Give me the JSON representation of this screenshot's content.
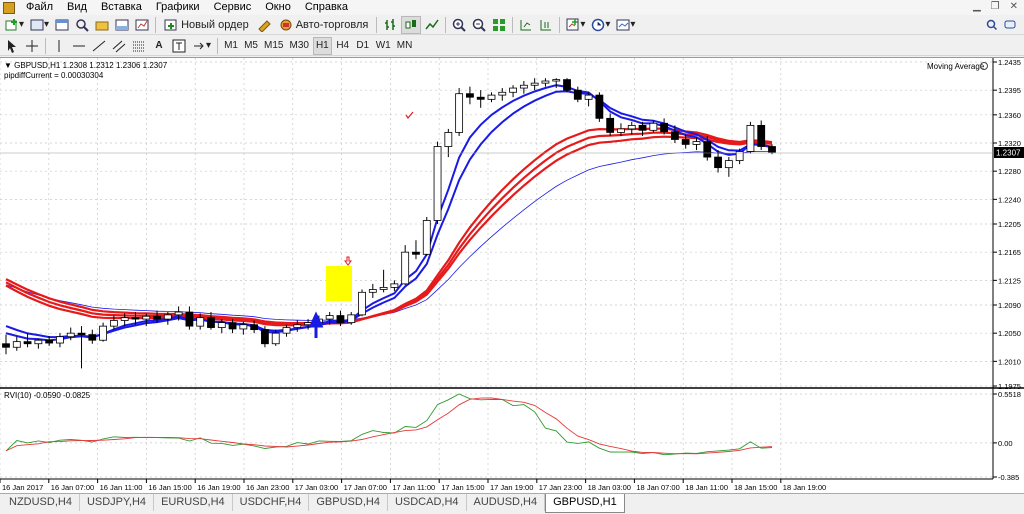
{
  "menu": [
    "Файл",
    "Вид",
    "Вставка",
    "Графики",
    "Сервис",
    "Окно",
    "Справка"
  ],
  "toolbar": {
    "new_order": "Новый ордер",
    "auto_trading": "Авто-торговля"
  },
  "timeframes": [
    "M1",
    "M5",
    "M15",
    "M30",
    "H1",
    "H4",
    "D1",
    "W1",
    "MN"
  ],
  "active_timeframe": "H1",
  "chart": {
    "info": "GBPUSD,H1  1.2308 1.2312 1.2306 1.2307",
    "indicator_label": "pipdiffCurrent = 0.00030304",
    "ma_label": "Moving Average",
    "current_price": "1.2307",
    "y_ticks": [
      "1.2435",
      "1.2395",
      "1.2360",
      "1.2320",
      "1.2280",
      "1.2240",
      "1.2205",
      "1.2165",
      "1.2125",
      "1.2090",
      "1.2050",
      "1.2010",
      "1.1975"
    ],
    "y_range": [
      1.1975,
      1.2435
    ]
  },
  "rvi": {
    "label": "RVI(10) -0.0590 -0.0825",
    "y_ticks": [
      "0.5518",
      "0.00",
      "-0.385"
    ]
  },
  "x_ticks": [
    "16 Jan 2017",
    "16 Jan 07:00",
    "16 Jan 11:00",
    "16 Jan 15:00",
    "16 Jan 19:00",
    "16 Jan 23:00",
    "17 Jan 03:00",
    "17 Jan 07:00",
    "17 Jan 11:00",
    "17 Jan 15:00",
    "17 Jan 19:00",
    "17 Jan 23:00",
    "18 Jan 03:00",
    "18 Jan 07:00",
    "18 Jan 11:00",
    "18 Jan 15:00",
    "18 Jan 19:00"
  ],
  "tabs": [
    "NZDUSD,H4",
    "USDJPY,H4",
    "EURUSD,H4",
    "USDCHF,H4",
    "GBPUSD,H4",
    "USDCAD,H4",
    "AUDUSD,H4",
    "GBPUSD,H1"
  ],
  "active_tab": "GBPUSD,H1",
  "colors": {
    "bull": "#ffffff",
    "bear": "#000000",
    "ma_blue": "#1a1ae6",
    "ma_red": "#e61a1a",
    "rvi_green": "#2e9a2e",
    "rvi_red": "#e63a3a",
    "highlight": "#ffff00"
  },
  "chart_data": {
    "type": "candlestick",
    "symbol": "GBPUSD",
    "timeframe": "H1",
    "ohlc": [
      [
        1.2035,
        1.2048,
        1.202,
        1.203
      ],
      [
        1.203,
        1.2045,
        1.2025,
        1.2038
      ],
      [
        1.2038,
        1.205,
        1.203,
        1.2035
      ],
      [
        1.2035,
        1.2042,
        1.2028,
        1.204
      ],
      [
        1.204,
        1.2046,
        1.2032,
        1.2036
      ],
      [
        1.2036,
        1.205,
        1.203,
        1.2045
      ],
      [
        1.2045,
        1.2058,
        1.204,
        1.205
      ],
      [
        1.205,
        1.206,
        1.2,
        1.2048
      ],
      [
        1.2048,
        1.2055,
        1.2035,
        1.204
      ],
      [
        1.204,
        1.2065,
        1.2038,
        1.206
      ],
      [
        1.206,
        1.2075,
        1.2055,
        1.2068
      ],
      [
        1.2068,
        1.2078,
        1.206,
        1.2072
      ],
      [
        1.2072,
        1.208,
        1.2062,
        1.207
      ],
      [
        1.207,
        1.2078,
        1.206,
        1.2074
      ],
      [
        1.2074,
        1.2082,
        1.2065,
        1.207
      ],
      [
        1.207,
        1.208,
        1.2062,
        1.2076
      ],
      [
        1.2076,
        1.2088,
        1.2068,
        1.208
      ],
      [
        1.208,
        1.2088,
        1.2055,
        1.206
      ],
      [
        1.206,
        1.2078,
        1.2055,
        1.2072
      ],
      [
        1.2072,
        1.208,
        1.2055,
        1.2058
      ],
      [
        1.2058,
        1.207,
        1.205,
        1.2065
      ],
      [
        1.2065,
        1.207,
        1.205,
        1.2056
      ],
      [
        1.2056,
        1.2066,
        1.2048,
        1.2062
      ],
      [
        1.2062,
        1.2068,
        1.205,
        1.2055
      ],
      [
        1.2055,
        1.206,
        1.203,
        1.2035
      ],
      [
        1.2035,
        1.2055,
        1.2032,
        1.205
      ],
      [
        1.205,
        1.2062,
        1.2045,
        1.2058
      ],
      [
        1.2058,
        1.2068,
        1.2052,
        1.2062
      ],
      [
        1.2062,
        1.207,
        1.2055,
        1.2065
      ],
      [
        1.2065,
        1.2075,
        1.2058,
        1.207
      ],
      [
        1.207,
        1.208,
        1.2062,
        1.2075
      ],
      [
        1.2075,
        1.2082,
        1.206,
        1.2065
      ],
      [
        1.2065,
        1.208,
        1.2062,
        1.2076
      ],
      [
        1.2076,
        1.2112,
        1.2074,
        1.2108
      ],
      [
        1.2108,
        1.212,
        1.21,
        1.2112
      ],
      [
        1.2112,
        1.214,
        1.2108,
        1.2115
      ],
      [
        1.2115,
        1.2125,
        1.211,
        1.212
      ],
      [
        1.212,
        1.2175,
        1.2118,
        1.2165
      ],
      [
        1.2165,
        1.2182,
        1.2155,
        1.2162
      ],
      [
        1.2162,
        1.2215,
        1.216,
        1.221
      ],
      [
        1.221,
        1.2322,
        1.2205,
        1.2315
      ],
      [
        1.2315,
        1.234,
        1.23,
        1.2335
      ],
      [
        1.2335,
        1.2398,
        1.233,
        1.239
      ],
      [
        1.239,
        1.24,
        1.2375,
        1.2385
      ],
      [
        1.2385,
        1.2395,
        1.237,
        1.2382
      ],
      [
        1.2382,
        1.2392,
        1.2378,
        1.2388
      ],
      [
        1.2388,
        1.2398,
        1.238,
        1.2392
      ],
      [
        1.2392,
        1.2402,
        1.2385,
        1.2398
      ],
      [
        1.2398,
        1.2408,
        1.239,
        1.2402
      ],
      [
        1.2402,
        1.2412,
        1.2395,
        1.2405
      ],
      [
        1.2405,
        1.2412,
        1.24,
        1.2408
      ],
      [
        1.2408,
        1.2412,
        1.2398,
        1.241
      ],
      [
        1.241,
        1.2412,
        1.2392,
        1.2395
      ],
      [
        1.2395,
        1.24,
        1.2378,
        1.2382
      ],
      [
        1.2382,
        1.2392,
        1.2372,
        1.2388
      ],
      [
        1.2388,
        1.2392,
        1.235,
        1.2355
      ],
      [
        1.2355,
        1.2362,
        1.233,
        1.2335
      ],
      [
        1.2335,
        1.2348,
        1.233,
        1.234
      ],
      [
        1.234,
        1.235,
        1.2332,
        1.2345
      ],
      [
        1.2345,
        1.235,
        1.233,
        1.2338
      ],
      [
        1.2338,
        1.2352,
        1.2335,
        1.2348
      ],
      [
        1.2348,
        1.2355,
        1.2332,
        1.2336
      ],
      [
        1.2336,
        1.2345,
        1.232,
        1.2325
      ],
      [
        1.2325,
        1.2332,
        1.2312,
        1.2318
      ],
      [
        1.2318,
        1.2328,
        1.231,
        1.2322
      ],
      [
        1.2322,
        1.233,
        1.2295,
        1.23
      ],
      [
        1.23,
        1.231,
        1.2278,
        1.2285
      ],
      [
        1.2285,
        1.23,
        1.2272,
        1.2295
      ],
      [
        1.2295,
        1.2312,
        1.229,
        1.2308
      ],
      [
        1.2308,
        1.235,
        1.2305,
        1.2345
      ],
      [
        1.2345,
        1.2352,
        1.231,
        1.2315
      ],
      [
        1.2315,
        1.2318,
        1.2304,
        1.2307
      ]
    ]
  }
}
